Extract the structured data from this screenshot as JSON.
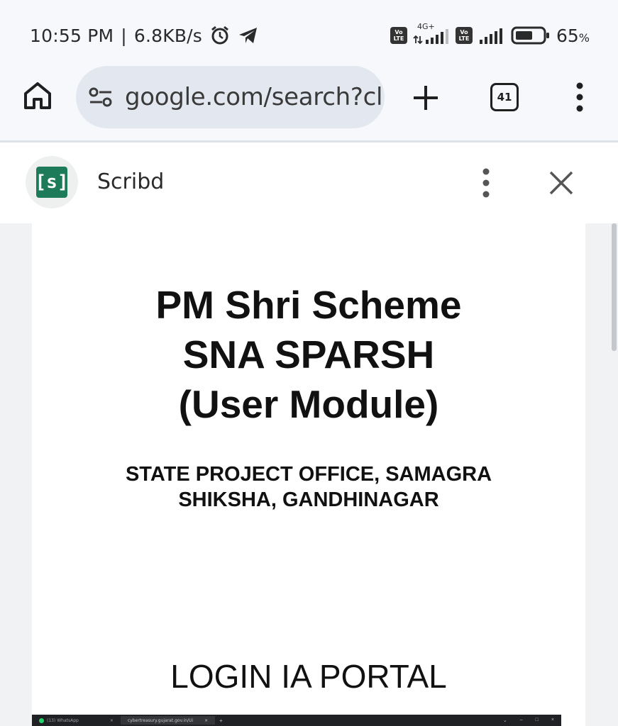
{
  "status_bar": {
    "time": "10:55 PM",
    "separator": "|",
    "speed": "6.8KB/s",
    "network_type": "4G+",
    "volte_top": "Vo",
    "volte_bottom": "LTE",
    "battery_percent": "65",
    "battery_unit": "%",
    "battery_level": 0.65,
    "icons": [
      "alarm-icon",
      "telegram-icon",
      "volte-icon",
      "signal-icon",
      "battery-icon"
    ]
  },
  "browser": {
    "url": "google.com/search?cl",
    "tab_count": "41",
    "icons": [
      "home-icon",
      "site-settings-icon",
      "new-tab-icon",
      "tabs-icon",
      "menu-icon"
    ]
  },
  "custom_tab": {
    "logo_text": "[s]",
    "site_name": "Scribd",
    "accent_color": "#1e7b5a"
  },
  "document": {
    "title_lines": [
      "PM Shri Scheme",
      "SNA SPARSH",
      "(User Module)"
    ],
    "subtitle_lines": [
      "STATE PROJECT OFFICE, SAMAGRA",
      "SHIKSHA, GANDHINAGAR"
    ],
    "section_heading": "LOGIN IA PORTAL",
    "embedded_screenshot": {
      "tab1": "(13) WhatsApp",
      "tab2": "cybertreasury.gujarat.gov.in/Ui",
      "tab_close": "×",
      "new_tab": "+",
      "controls": [
        "⌄",
        "–",
        "□",
        "×"
      ]
    }
  }
}
